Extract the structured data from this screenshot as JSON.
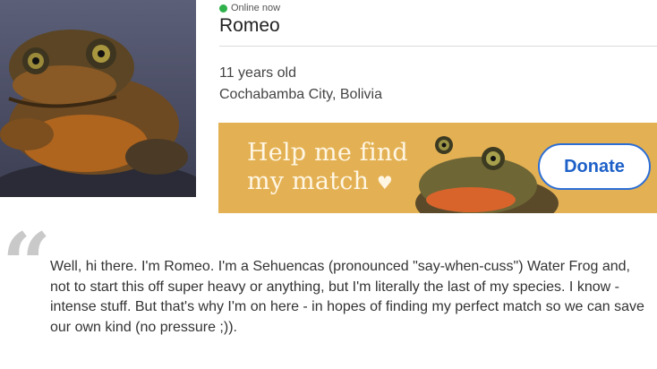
{
  "profile": {
    "status": "Online now",
    "name": "Romeo",
    "age": "11 years old",
    "location": "Cochabamba City, Bolivia",
    "status_color": "#2fb14b"
  },
  "banner": {
    "headline_line1": "Help me find",
    "headline_line2": "my match",
    "heart": "♥",
    "donate_label": "Donate",
    "background_color": "#e3b153",
    "button_color": "#1d60c8"
  },
  "bio": {
    "quote_mark": "“",
    "text": "Well, hi there. I'm Romeo. I'm a Sehuencas (pronounced \"say-when-cuss\") Water Frog and, not to start this off super heavy or anything, but I'm literally the last of my species. I know - intense stuff. But that's why I'm on here - in hopes of finding my perfect match so we can save our own kind (no pressure ;))."
  }
}
